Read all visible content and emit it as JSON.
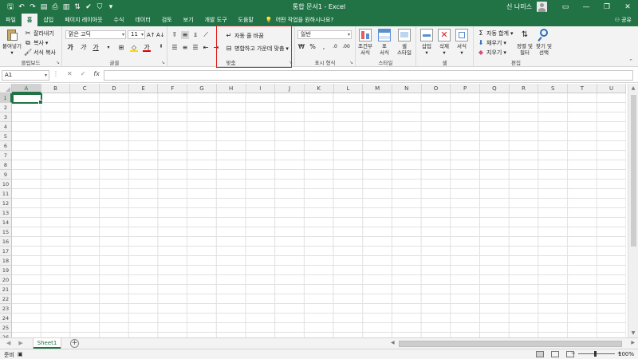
{
  "app": {
    "title": "통합 문서1 - Excel",
    "user": "신 나미스",
    "window_controls": [
      "—",
      "❐",
      "✕"
    ],
    "accent": "#217346"
  },
  "quick_access": [
    "save-icon",
    "undo-icon",
    "redo-icon",
    "more-icon"
  ],
  "tabs": [
    {
      "label": "파일",
      "active": false
    },
    {
      "label": "홈",
      "active": true
    },
    {
      "label": "삽입",
      "active": false
    },
    {
      "label": "페이지 레이아웃",
      "active": false
    },
    {
      "label": "수식",
      "active": false
    },
    {
      "label": "데이터",
      "active": false
    },
    {
      "label": "검토",
      "active": false
    },
    {
      "label": "보기",
      "active": false
    },
    {
      "label": "개발 도구",
      "active": false
    },
    {
      "label": "도움말",
      "active": false
    }
  ],
  "tellme": "어떤 작업을 원하시나요?",
  "share": "공유",
  "ribbon": {
    "clipboard": {
      "label": "클립보드",
      "paste": "붙여넣기",
      "cut": "잘라내기",
      "copy": "복사",
      "format_painter": "서식 복사"
    },
    "font": {
      "label": "글꼴",
      "font_name": "맑은 고딕",
      "font_size": "11",
      "bold": "가",
      "italic": "가",
      "underline": "가"
    },
    "alignment": {
      "label": "맞춤",
      "wrap_text": "자동 줄 바꿈",
      "merge_center": "병합하고 가운데 맞춤"
    },
    "number": {
      "label": "표시 형식",
      "format": "일반",
      "percent": "%",
      "comma": ","
    },
    "styles": {
      "label": "스타일",
      "conditional": "조건부",
      "conditional_2": "서식",
      "table": "표",
      "table_2": "서식",
      "cell_styles": "셀",
      "cell_styles_2": "스타일"
    },
    "cells": {
      "label": "셀",
      "insert": "삽입",
      "delete": "삭제",
      "format": "서식"
    },
    "editing": {
      "label": "편집",
      "autosum": "자동 합계",
      "fill": "채우기",
      "clear": "지우기",
      "sort_filter": "정렬 및",
      "sort_filter_2": "필터",
      "find_select": "찾기 및",
      "find_select_2": "선택"
    }
  },
  "formula_bar": {
    "name_box": "A1",
    "cancel": "✕",
    "enter": "✓",
    "fx": "fx",
    "value": ""
  },
  "columns": [
    "A",
    "B",
    "C",
    "D",
    "E",
    "F",
    "G",
    "H",
    "I",
    "J",
    "K",
    "L",
    "M",
    "N",
    "O",
    "P",
    "Q",
    "R",
    "S",
    "T",
    "U"
  ],
  "rows": [
    "1",
    "2",
    "3",
    "4",
    "5",
    "6",
    "7",
    "8",
    "9",
    "10",
    "11",
    "12",
    "13",
    "14",
    "15",
    "16",
    "17",
    "18",
    "19",
    "20",
    "21",
    "22",
    "23",
    "24",
    "25",
    "26"
  ],
  "active_cell": "A1",
  "sheets": [
    {
      "label": "Sheet1",
      "active": true
    }
  ],
  "status": {
    "ready": "준비",
    "zoom": "100%"
  }
}
